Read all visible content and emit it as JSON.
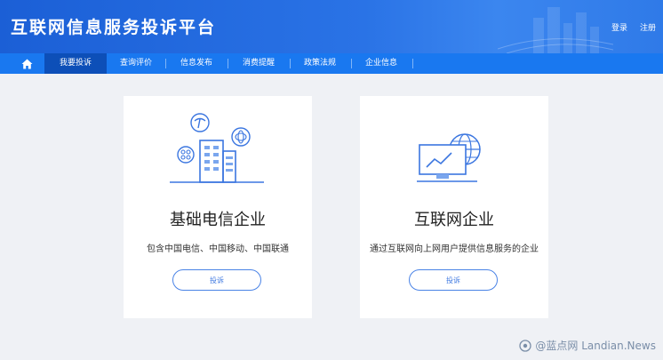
{
  "header": {
    "title": "互联网信息服务投诉平台",
    "login": "登录",
    "register": "注册"
  },
  "nav": {
    "home_icon": "home-icon",
    "items": [
      "我要投诉",
      "查询评价",
      "信息发布",
      "消费提醒",
      "政策法规",
      "企业信息"
    ]
  },
  "cards": [
    {
      "title": "基础电信企业",
      "desc": "包含中国电信、中国移动、中国联通",
      "button": "投诉"
    },
    {
      "title": "互联网企业",
      "desc": "通过互联网向上网用户提供信息服务的企业",
      "button": "投诉"
    }
  ],
  "watermark": "@蓝点网 Landian.News",
  "colors": {
    "header": "#2a73e6",
    "nav": "#1978f0",
    "nav_active": "#0d4fb8",
    "accent": "#3b76e0"
  }
}
